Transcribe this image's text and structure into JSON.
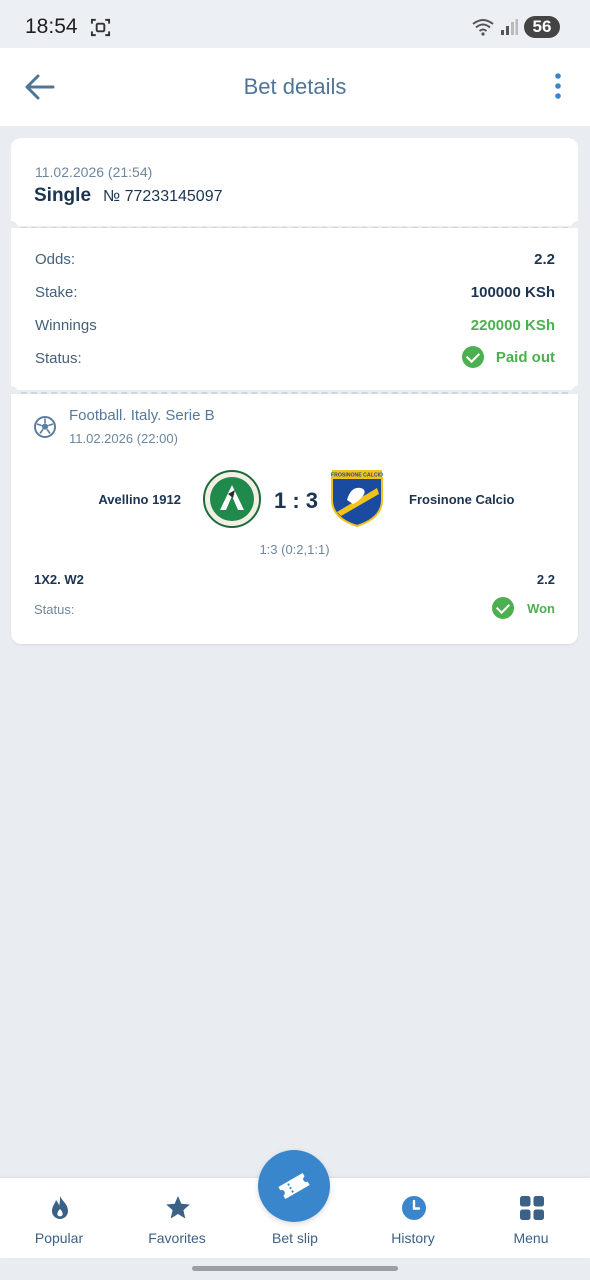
{
  "status_bar": {
    "time": "18:54",
    "battery": "56"
  },
  "header": {
    "title": "Bet details"
  },
  "bet": {
    "date": "11.02.2026 (21:54)",
    "type": "Single",
    "number": "№ 77233145097",
    "odds_label": "Odds:",
    "odds_value": "2.2",
    "stake_label": "Stake:",
    "stake_value": "100000 KSh",
    "winnings_label": "Winnings",
    "winnings_value": "220000 KSh",
    "status_label": "Status:",
    "status_value": "Paid out"
  },
  "event": {
    "league": "Football. Italy. Serie B",
    "date": "11.02.2026 (22:00)",
    "home_team": "Avellino 1912",
    "away_team": "Frosinone Calcio",
    "score": "1 : 3",
    "score_detail": "1:3 (0:2,1:1)",
    "market": "1X2. W2",
    "market_odds": "2.2",
    "status_label": "Status:",
    "status_value": "Won",
    "away_logo_text": "FROSINONE CALCIO"
  },
  "nav": {
    "items": [
      {
        "label": "Popular",
        "icon": "flame-icon"
      },
      {
        "label": "Favorites",
        "icon": "star-icon"
      },
      {
        "label": "Bet slip",
        "icon": "ticket-icon"
      },
      {
        "label": "History",
        "icon": "clock-icon"
      },
      {
        "label": "Menu",
        "icon": "grid-icon"
      }
    ]
  },
  "colors": {
    "accent": "#3a86cc",
    "success": "#4cb050",
    "text_dark": "#1b3452",
    "background": "#e9edf1"
  }
}
